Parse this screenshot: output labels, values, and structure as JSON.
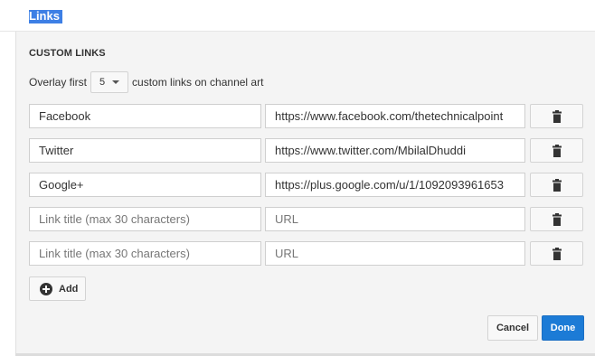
{
  "heading": "Links",
  "section_title": "CUSTOM LINKS",
  "overlay": {
    "prefix": "Overlay first",
    "selected_count": "5",
    "suffix": "custom links on channel art"
  },
  "links": [
    {
      "title": "Facebook",
      "url": "https://www.facebook.com/thetechnicalpoint"
    },
    {
      "title": "Twitter",
      "url": "https://www.twitter.com/MbilalDhuddi"
    },
    {
      "title": "Google+",
      "url": "https://plus.google.com/u/1/1092093961653"
    },
    {
      "title": "",
      "url": ""
    },
    {
      "title": "",
      "url": ""
    }
  ],
  "placeholders": {
    "title": "Link title (max 30 characters)",
    "url": "URL"
  },
  "icons": {
    "remove": "trash-icon",
    "add": "plus-circle-icon",
    "dropdown": "chevron-down-icon"
  },
  "buttons": {
    "add": "Add",
    "cancel": "Cancel",
    "done": "Done"
  },
  "colors": {
    "accent": "#1c7bd6",
    "selection": "#3d7fe5",
    "panel": "#f4f4f4"
  }
}
